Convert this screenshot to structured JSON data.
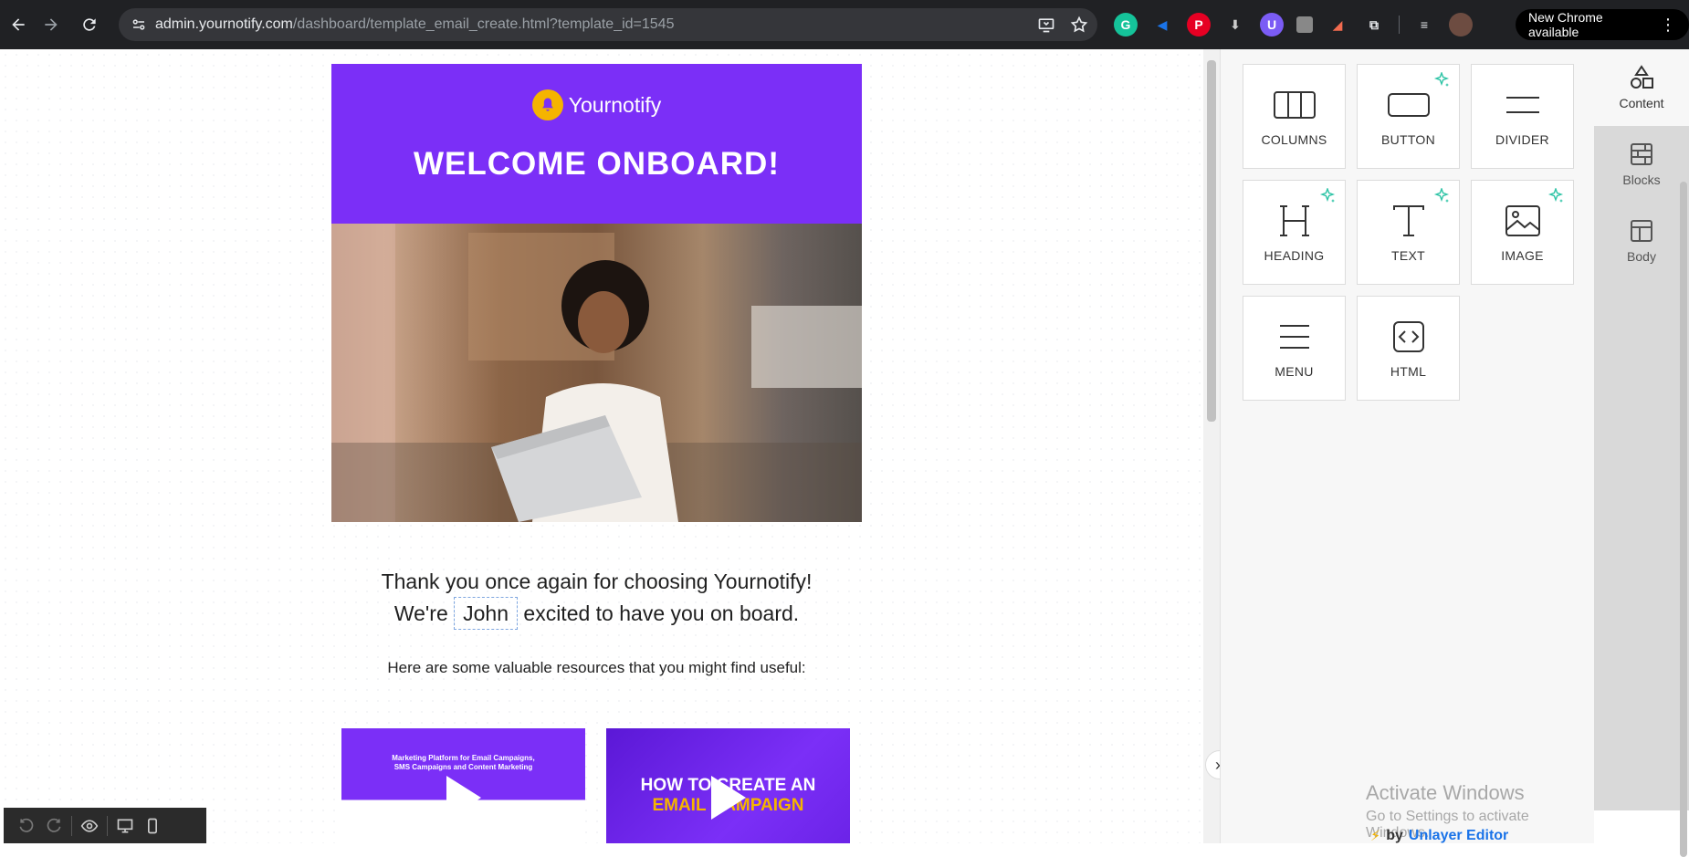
{
  "browser": {
    "url_host": "admin.yournotify.com",
    "url_path": "/dashboard/template_email_create.html?template_id=1545",
    "update_label": "New Chrome available"
  },
  "email": {
    "brand": "Yournotify",
    "headline": "WELCOME ONBOARD!",
    "thanks_line1": "Thank you once again for choosing Yournotify!",
    "thanks_line2_prefix": "We're",
    "merge_name": "John",
    "thanks_line2_suffix": "excited to have you on board.",
    "resources_text": "Here are some valuable resources that you might find useful:",
    "thumb1_text": "Marketing Platform for Email Campaigns, SMS Campaigns and Content Marketing",
    "thumb2_line1": "HOW TO CREATE AN",
    "thumb2_line2": "EMAIL CAMPAIGN"
  },
  "tiles": [
    {
      "label": "COLUMNS",
      "icon": "columns-icon",
      "ai": false
    },
    {
      "label": "BUTTON",
      "icon": "button-icon",
      "ai": true
    },
    {
      "label": "DIVIDER",
      "icon": "divider-icon",
      "ai": false
    },
    {
      "label": "HEADING",
      "icon": "heading-icon",
      "ai": true
    },
    {
      "label": "TEXT",
      "icon": "text-icon",
      "ai": true
    },
    {
      "label": "IMAGE",
      "icon": "image-icon",
      "ai": true
    },
    {
      "label": "MENU",
      "icon": "menu-icon",
      "ai": false
    },
    {
      "label": "HTML",
      "icon": "html-icon",
      "ai": false
    }
  ],
  "tabs": [
    {
      "label": "Content",
      "icon": "shapes-icon",
      "active": true
    },
    {
      "label": "Blocks",
      "icon": "blocks-icon",
      "active": false
    },
    {
      "label": "Body",
      "icon": "body-icon",
      "active": false
    }
  ],
  "watermark": {
    "line1": "Activate Windows",
    "line2": "Go to Settings to activate Windows."
  },
  "footer": {
    "by": "by",
    "brand": "Unlayer Editor"
  },
  "colors": {
    "email_header": "#7b2ff7",
    "logo_bell": "#f5b400",
    "accent_link": "#1a73e8"
  }
}
